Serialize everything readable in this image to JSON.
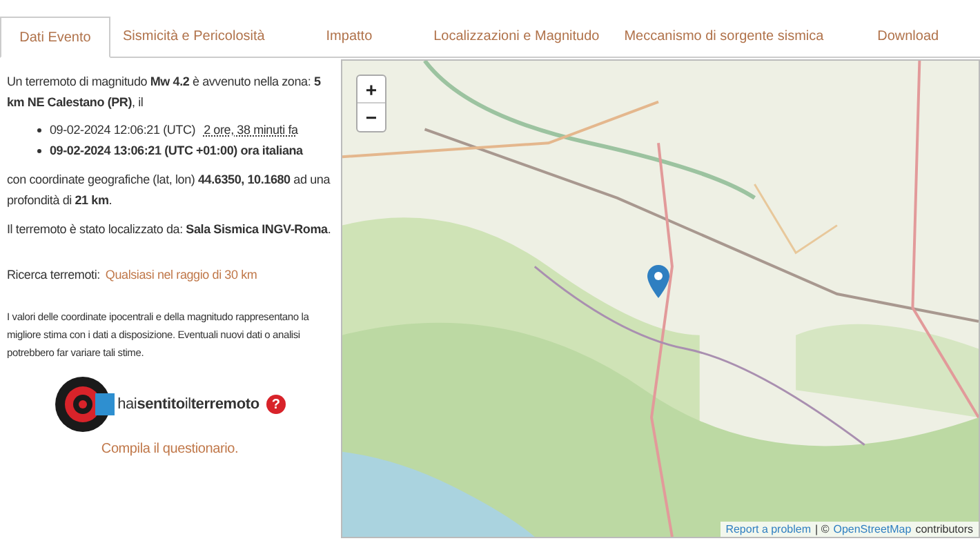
{
  "tabs": [
    {
      "label": "Dati Evento",
      "selected": true
    },
    {
      "label": "Sismicità e Pericolosità",
      "selected": false
    },
    {
      "label": "Impatto",
      "selected": false
    },
    {
      "label": "Localizzazioni e Magnitudo",
      "selected": false
    },
    {
      "label": "Meccanismo di sorgente sismica",
      "selected": false
    },
    {
      "label": "Download",
      "selected": false
    }
  ],
  "event": {
    "intro": "Un terremoto di magnitudo **Mw 4.2** è avvenuto nella zona: **5 km NE Calestano (PR)**, il",
    "times": [
      {
        "text": "09-02-2024 12:06:21 (UTC)",
        "ago": "2 ore, 38 minuti fa",
        "bold": false
      },
      {
        "text": "09-02-2024 13:06:21 (UTC +01:00) ora italiana",
        "bold": true
      }
    ],
    "coords": "con coordinate geografiche (lat, lon) **44.6350, 10.1680** ad una profondità di **21 km**.",
    "located": "Il terremoto è stato localizzato da: **Sala Sismica INGV-Roma**.",
    "search_label": "Ricerca terremoti:",
    "search_link": "Qualsiasi nel raggio di 30 km",
    "note": "I valori delle coordinate ipocentrali e della magnitudo rappresentano la migliore stima con i dati a disposizione. Eventuali nuovi dati o analisi potrebbero far variare tali stime.",
    "logo_text": "hai**sentito**il**terremoto**",
    "logo_badge": "?",
    "questionnaire": "Compila il questionario."
  },
  "map": {
    "zoom_in": "+",
    "zoom_out": "−",
    "report": "Report a problem",
    "separator": "| ©",
    "osm": "OpenStreetMap",
    "contributors": "contributors"
  }
}
